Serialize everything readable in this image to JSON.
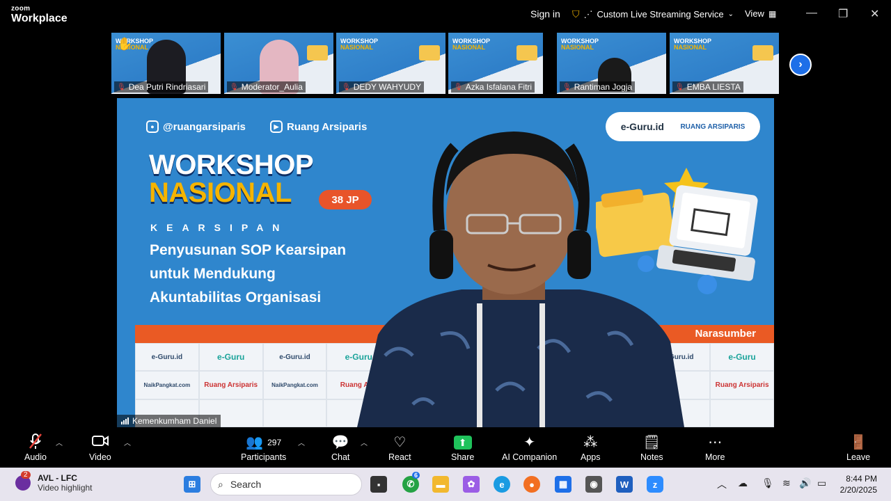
{
  "window": {
    "logo_small": "zoom",
    "logo_big": "Workplace",
    "sign_in": "Sign in",
    "streaming": "Custom Live Streaming Service",
    "view": "View"
  },
  "participants_strip": [
    {
      "name": "Dea Putri Rindriasari",
      "avatar_color": "#1c1c22"
    },
    {
      "name": "Moderator_Aulia",
      "avatar_color": "#e4b7c2"
    },
    {
      "name": "DEDY WAHYUDY",
      "avatar_color": ""
    },
    {
      "name": "Azka Isfalana Fitri",
      "avatar_color": ""
    },
    {
      "name": "Rantiman Jogja",
      "avatar_color": "#1a1a1a"
    },
    {
      "name": "EMBA LIESTA",
      "avatar_color": ""
    }
  ],
  "thumb_slide": {
    "title_1": "WORKSHOP",
    "title_2": "NASIONAL"
  },
  "main_slide": {
    "instagram": "@ruangarsiparis",
    "youtube": "Ruang Arsiparis",
    "brand_1": "e-Guru.id",
    "brand_2": "RUANG ARSIPARIS",
    "title_1": "WORKSHOP",
    "title_2": "NASIONAL",
    "jp_badge": "38 JP",
    "category": "KEARSIPAN",
    "subtitle_1": "Penyusunan SOP Kearsipan",
    "subtitle_2": "untuk Mendukung",
    "subtitle_3": "Akuntabilitas Organisasi",
    "narasumber": "Narasumber",
    "grid_row_1": [
      "e-Guru.id",
      "e-Guru",
      "e-Guru.id",
      "e-Guru",
      "",
      "",
      "",
      "",
      "e-Guru.id",
      "e-Guru"
    ],
    "grid_row_2": [
      "NaikPangkat.com",
      "Ruang Arsiparis",
      "NaikPangkat.com",
      "Ruang Arsi",
      "",
      "",
      "",
      "",
      "",
      "Ruang Arsiparis"
    ]
  },
  "speaker_label": "Kemenkumham Daniel",
  "toolbar": {
    "audio": "Audio",
    "video": "Video",
    "participants": "Participants",
    "participants_count": "297",
    "chat": "Chat",
    "react": "React",
    "share": "Share",
    "ai_companion": "AI Companion",
    "apps": "Apps",
    "notes": "Notes",
    "more": "More",
    "leave": "Leave"
  },
  "taskbar": {
    "notification_badge": "2",
    "widget_title": "AVL - LFC",
    "widget_sub": "Video highlight",
    "search": "Search",
    "whatsapp_badge": "6",
    "time": "8:44 PM",
    "date": "2/20/2025"
  },
  "colors": {
    "slide_blue": "#2f86cd",
    "accent_orange": "#ea5a24",
    "accent_yellow": "#f5b400",
    "share_green": "#1fc25b",
    "leave_red": "#e8453c"
  }
}
